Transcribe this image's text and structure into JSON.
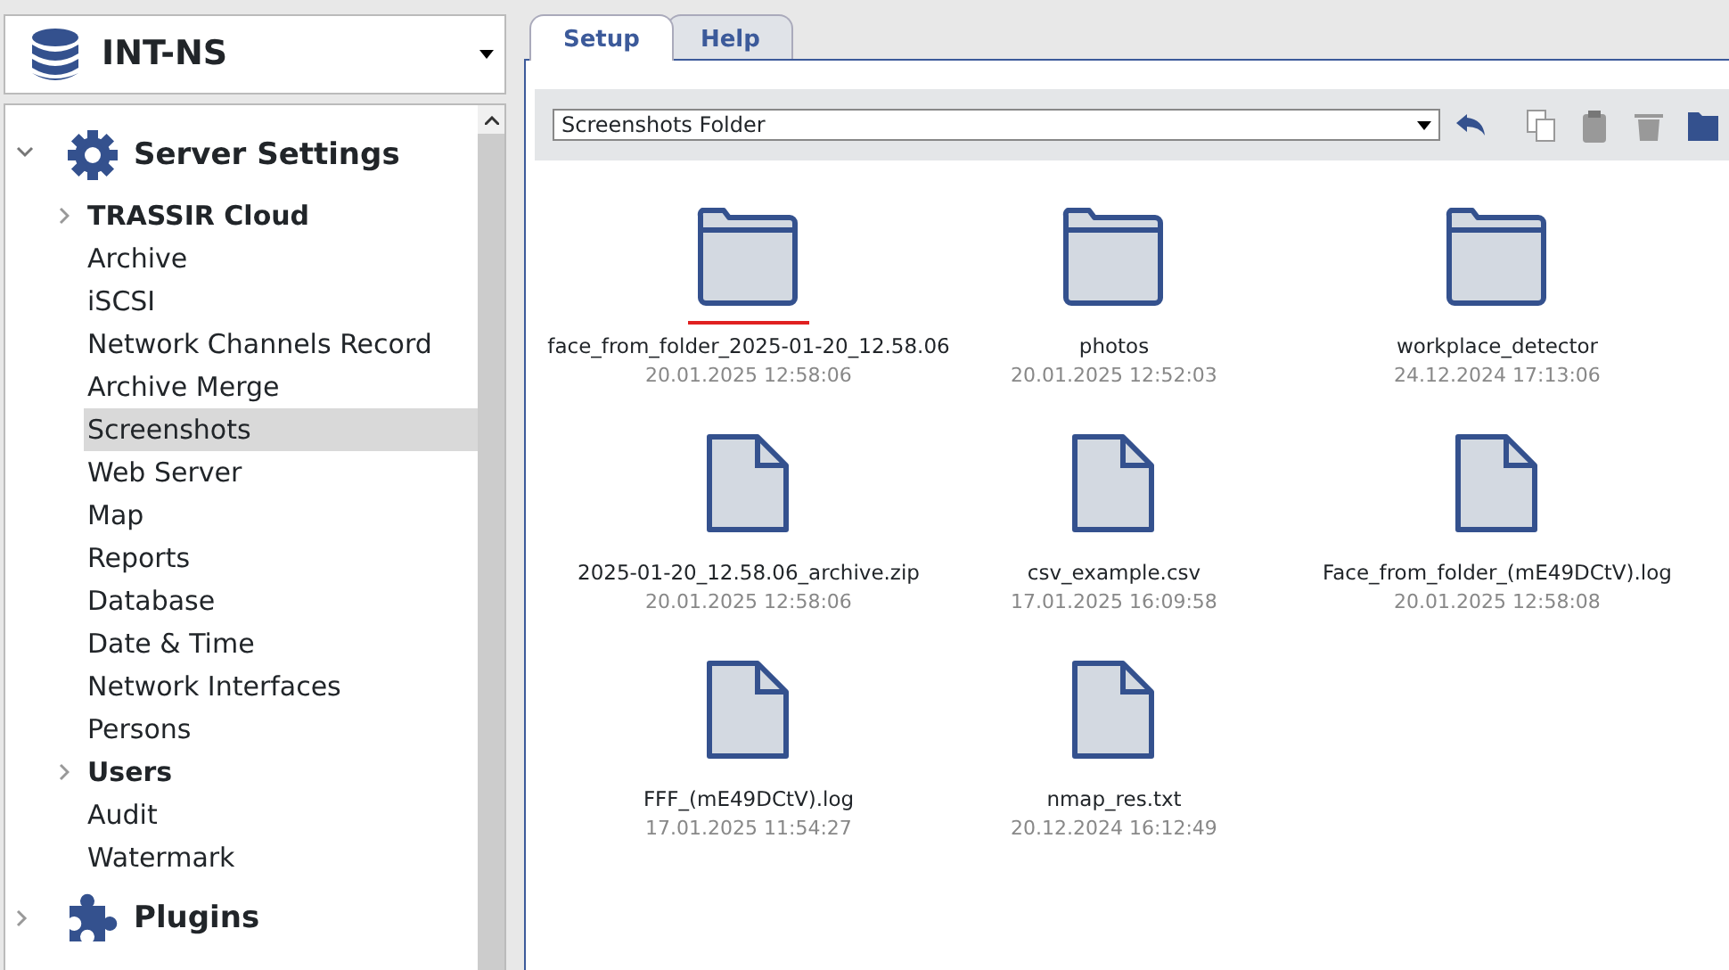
{
  "server": {
    "name": "INT-NS"
  },
  "tree": [
    {
      "label": "Server Settings",
      "expanded": true,
      "children": [
        {
          "label": "TRASSIR Cloud",
          "expandable": true,
          "selected": false
        },
        {
          "label": "Archive",
          "expandable": false,
          "selected": false
        },
        {
          "label": "iSCSI",
          "expandable": false,
          "selected": false
        },
        {
          "label": "Network Channels Record",
          "expandable": false,
          "selected": false
        },
        {
          "label": "Archive Merge",
          "expandable": false,
          "selected": false
        },
        {
          "label": "Screenshots",
          "expandable": false,
          "selected": true
        },
        {
          "label": "Web Server",
          "expandable": false,
          "selected": false
        },
        {
          "label": "Map",
          "expandable": false,
          "selected": false
        },
        {
          "label": "Reports",
          "expandable": false,
          "selected": false
        },
        {
          "label": "Database",
          "expandable": false,
          "selected": false
        },
        {
          "label": "Date & Time",
          "expandable": false,
          "selected": false
        },
        {
          "label": "Network Interfaces",
          "expandable": false,
          "selected": false
        },
        {
          "label": "Persons",
          "expandable": false,
          "selected": false
        },
        {
          "label": "Users",
          "expandable": true,
          "selected": false
        },
        {
          "label": "Audit",
          "expandable": false,
          "selected": false
        },
        {
          "label": "Watermark",
          "expandable": false,
          "selected": false
        }
      ]
    },
    {
      "label": "Plugins",
      "expanded": false
    }
  ],
  "tabs": [
    {
      "label": "Setup",
      "selected": true
    },
    {
      "label": "Help",
      "selected": false
    }
  ],
  "folder_select": {
    "value": "Screenshots Folder"
  },
  "files": [
    {
      "kind": "folder",
      "name": "face_from_folder_2025-01-20_12.58.06",
      "date": "20.01.2025 12:58:06",
      "marked": true
    },
    {
      "kind": "folder",
      "name": "photos",
      "date": "20.01.2025 12:52:03",
      "marked": false
    },
    {
      "kind": "folder",
      "name": "workplace_detector",
      "date": "24.12.2024 17:13:06",
      "marked": false
    },
    {
      "kind": "file",
      "name": "2025-01-20_12.58.06_archive.zip",
      "date": "20.01.2025 12:58:06",
      "marked": false
    },
    {
      "kind": "file",
      "name": "csv_example.csv",
      "date": "17.01.2025 16:09:58",
      "marked": false
    },
    {
      "kind": "file",
      "name": "Face_from_folder_(mE49DCtV).log",
      "date": "20.01.2025 12:58:08",
      "marked": false
    },
    {
      "kind": "file",
      "name": "FFF_(mE49DCtV).log",
      "date": "17.01.2025 11:54:27",
      "marked": false
    },
    {
      "kind": "file",
      "name": "nmap_res.txt",
      "date": "20.12.2024 16:12:49",
      "marked": false
    }
  ]
}
